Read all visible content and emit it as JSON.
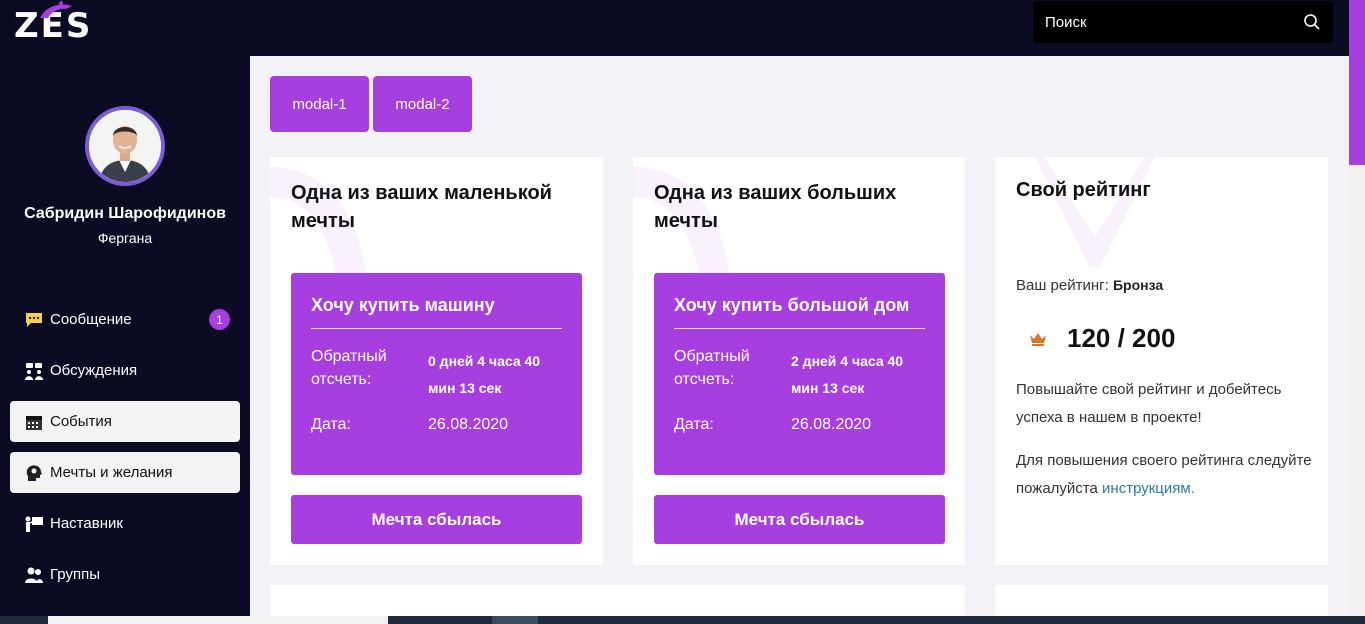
{
  "header": {
    "logo_text": "ZES",
    "search_placeholder": "Поиск",
    "search_icon": "search-icon"
  },
  "profile": {
    "name": "Сабридин Шарофидинов",
    "city": "Фергана"
  },
  "sidebar": {
    "items": [
      {
        "label": "Сообщение",
        "icon": "chat-icon",
        "badge": "1",
        "active": false
      },
      {
        "label": "Обсуждения",
        "icon": "group-discussion-icon",
        "active": false
      },
      {
        "label": "События",
        "icon": "calendar-icon",
        "active": true
      },
      {
        "label": "Мечты и желания",
        "icon": "head-thought-icon",
        "active": true
      },
      {
        "label": "Наставник",
        "icon": "mentor-icon",
        "active": false
      },
      {
        "label": "Группы",
        "icon": "users-icon",
        "active": false
      }
    ]
  },
  "tabs": [
    "modal-1",
    "modal-2"
  ],
  "cards": {
    "small_dream": {
      "title": "Одна из ваших маленькой мечты",
      "dream_title": "Хочу купить машину",
      "countdown_label": "Обратный отсчеть:",
      "countdown_value": "0 дней 4 часа 40 мин 13 сек",
      "date_label": "Дата:",
      "date_value": "26.08.2020",
      "button": "Мечта сбылась"
    },
    "big_dream": {
      "title": "Одна из ваших больших мечты",
      "dream_title": "Хочу купить большой дом",
      "countdown_label": "Обратный отсчеть:",
      "countdown_value": "2 дней 4 часа 40 мин 13 сек",
      "date_label": "Дата:",
      "date_value": "26.08.2020",
      "button": "Мечта сбылась"
    },
    "rating": {
      "title": "Свой рейтинг",
      "rating_label": "Ваш рейтинг:",
      "rating_value": "Бронза",
      "score": "120 / 200",
      "paragraph1": "Повышайте свой рейтинг и добейтесь успеха в нашем в проекте!",
      "paragraph2_prefix": "Для повышения своего рейтинга следуйте пожалуйста",
      "paragraph2_link": "инструкциям.",
      "icon": "crown-icon"
    }
  },
  "colors": {
    "accent": "#a63ee0",
    "dark": "#0b0c24",
    "link": "#2a7ab0",
    "crown": "#d07b2a"
  }
}
